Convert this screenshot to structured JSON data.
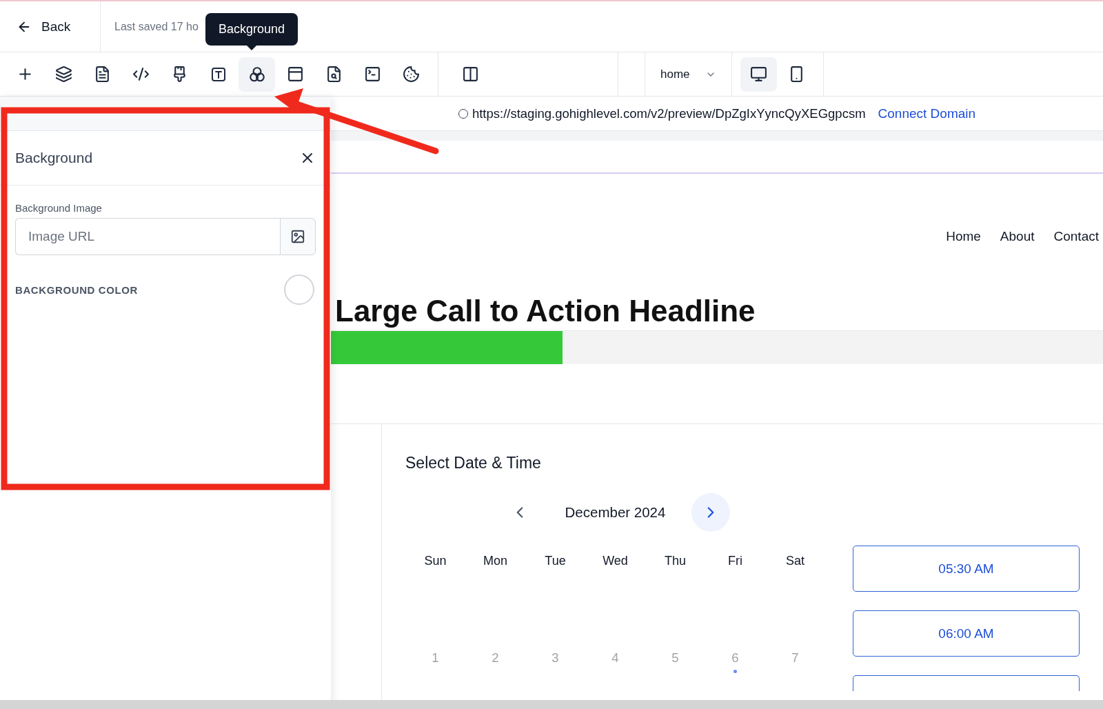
{
  "header": {
    "back": "Back",
    "last_saved": "Last saved 17 ho"
  },
  "tooltip": "Background",
  "toolbar": {
    "tools": [
      {
        "kind": "plus",
        "selected": false
      },
      {
        "kind": "layers",
        "selected": false
      },
      {
        "kind": "page",
        "selected": false
      },
      {
        "kind": "code",
        "selected": false
      },
      {
        "kind": "brush",
        "selected": false
      },
      {
        "kind": "text",
        "selected": false
      },
      {
        "kind": "background",
        "selected": true
      },
      {
        "kind": "window",
        "selected": false
      },
      {
        "kind": "search-page",
        "selected": false
      },
      {
        "kind": "terminal",
        "selected": false
      },
      {
        "kind": "cookie",
        "selected": false
      }
    ],
    "view_tools": [
      {
        "kind": "columns",
        "selected": false
      }
    ],
    "page_select": "home",
    "devices": [
      {
        "kind": "desktop",
        "selected": true
      },
      {
        "kind": "mobile",
        "selected": false
      }
    ]
  },
  "panel": {
    "title": "Background",
    "image_label": "Background Image",
    "image_placeholder": "Image URL",
    "color_label": "BACKGROUND COLOR"
  },
  "preview": {
    "url": "https://staging.gohighlevel.com/v2/preview/DpZgIxYyncQyXEGgpcsm",
    "connect": "Connect Domain",
    "nav": [
      "Home",
      "About",
      "Contact"
    ],
    "headline": "Large Call to Action Headline",
    "progress": {
      "level": 0.3
    },
    "calendar": {
      "title": "Select Date & Time",
      "month": "December 2024",
      "weekdays": [
        "Sun",
        "Mon",
        "Tue",
        "Wed",
        "Thu",
        "Fri",
        "Sat"
      ],
      "dates": [
        {
          "label": "1",
          "marked": false
        },
        {
          "label": "2",
          "marked": false
        },
        {
          "label": "3",
          "marked": false
        },
        {
          "label": "4",
          "marked": false
        },
        {
          "label": "5",
          "marked": false
        },
        {
          "label": "6",
          "marked": true
        },
        {
          "label": "7",
          "marked": false
        }
      ],
      "times": [
        "05:30 AM",
        "06:00 AM"
      ]
    }
  }
}
